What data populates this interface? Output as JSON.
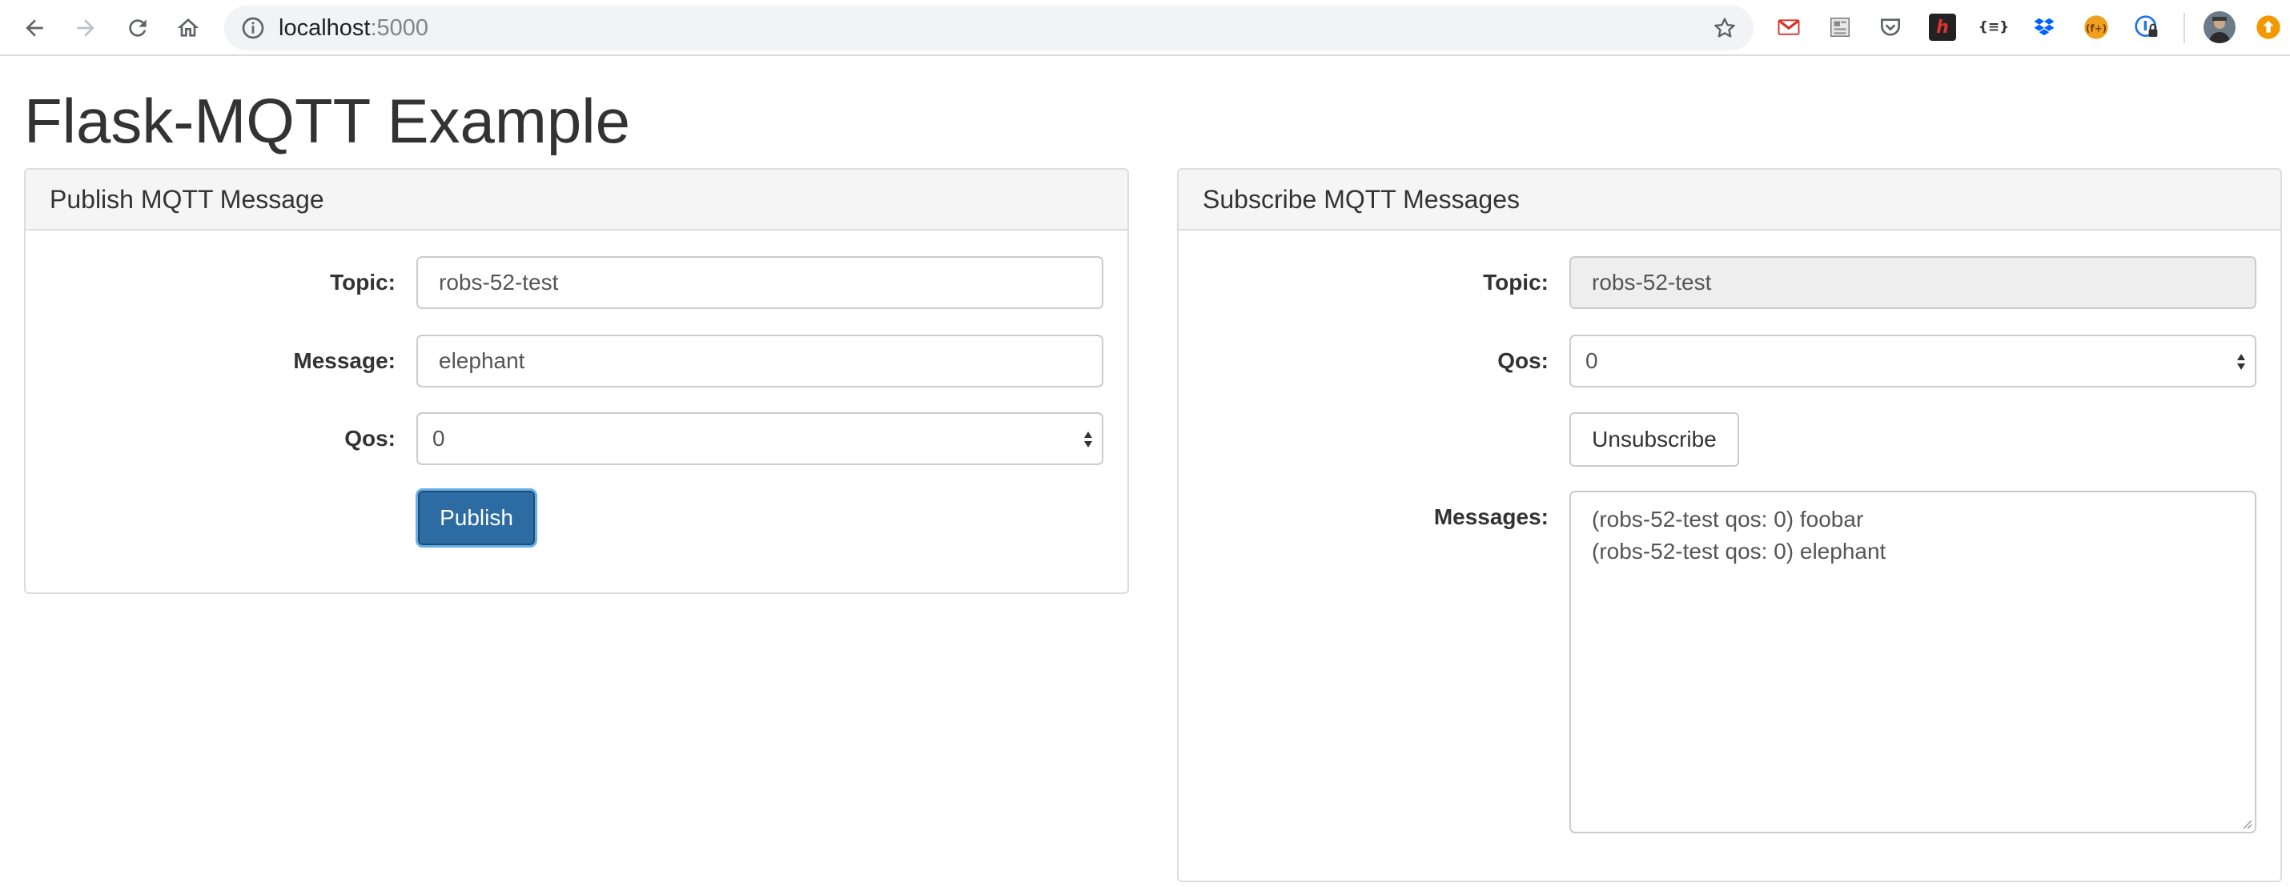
{
  "browser": {
    "url_host": "localhost",
    "url_port": ":5000",
    "icons": [
      "back-icon",
      "forward-icon",
      "reload-icon",
      "home-icon",
      "site-info-icon",
      "bookmark-star-icon"
    ],
    "extensions": [
      "gmail-icon",
      "extension-doc-icon",
      "pocket-icon",
      "extension-h-icon",
      "json-formatter-icon",
      "dropbox-icon",
      "extension-orange-icon",
      "extension-lock-icon",
      "profile-avatar",
      "update-icon"
    ]
  },
  "page": {
    "title": "Flask-MQTT Example"
  },
  "publish": {
    "heading": "Publish MQTT Message",
    "topic_label": "Topic:",
    "topic_value": "robs-52-test",
    "message_label": "Message:",
    "message_value": "elephant",
    "qos_label": "Qos:",
    "qos_value": "0",
    "publish_button": "Publish"
  },
  "subscribe": {
    "heading": "Subscribe MQTT Messages",
    "topic_label": "Topic:",
    "topic_value": "robs-52-test",
    "qos_label": "Qos:",
    "qos_value": "0",
    "unsubscribe_button": "Unsubscribe",
    "messages_label": "Messages:",
    "messages": [
      "(robs-52-test qos: 0) foobar",
      "(robs-52-test qos: 0) elephant"
    ]
  },
  "colors": {
    "primary_button": "#2d6ca2",
    "panel_heading_bg": "#f5f5f5",
    "readonly_bg": "#eeeeee"
  }
}
